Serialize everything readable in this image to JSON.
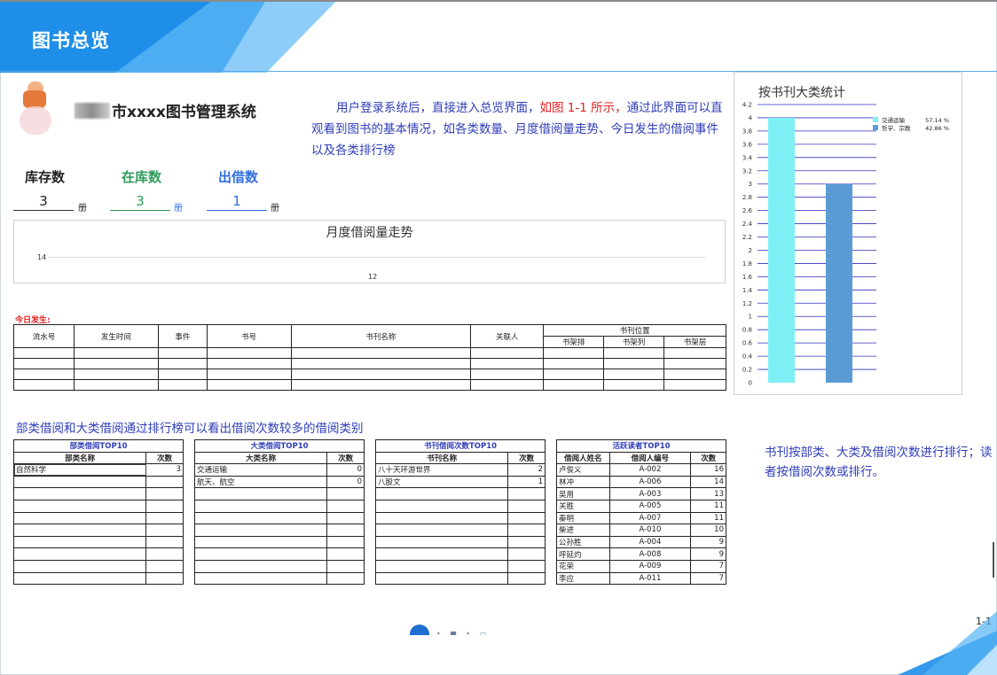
{
  "banner": {
    "title": "图书总览"
  },
  "app": {
    "title": "市xxxx图书管理系统"
  },
  "description": {
    "part1": "用户登录系统后，直接进入总览界面，",
    "highlight": "如图 1-1 所示，",
    "part2": "通过此界面可以直观看到图书的基本情况，如各类数量、月度借阅量走势、今日发生的借阅事件以及各类排行榜"
  },
  "stats": [
    {
      "label": "库存数",
      "value": "3",
      "unit": "册",
      "color": "#111111"
    },
    {
      "label": "在库数",
      "value": "3",
      "unit": "册",
      "color": "#2e9a5a"
    },
    {
      "label": "出借数",
      "value": "1",
      "unit": "册",
      "color": "#2f6fe0"
    }
  ],
  "trend": {
    "title": "月度借阅量走势",
    "ytick": "14",
    "xtick": "12"
  },
  "today": {
    "label": "今日发生:",
    "columns": [
      "流水号",
      "发生时间",
      "事件",
      "书号",
      "书刊名称",
      "关联人"
    ],
    "location_header": "书刊位置",
    "location_columns": [
      "书架排",
      "书架列",
      "书架层"
    ]
  },
  "ranking": {
    "heading": "部类借阅和大类借阅通过排行榜可以看出借阅次数较多的借阅类别",
    "note": "书刊按部类、大类及借阅次数进行排行；读者按借阅次数或排行。",
    "dept": {
      "caption": "部类借阅TOP10",
      "columns": [
        "部类名称",
        "次数"
      ],
      "rows": [
        [
          "自然科学",
          "3"
        ]
      ]
    },
    "category": {
      "caption": "大类借阅TOP10",
      "columns": [
        "大类名称",
        "次数"
      ],
      "rows": [
        [
          "交通运输",
          "0"
        ],
        [
          "航天、航空",
          "0"
        ]
      ]
    },
    "books": {
      "caption": "书刊借阅次数TOP10",
      "columns": [
        "书刊名称",
        "次数"
      ],
      "rows": [
        [
          "八十天环游世界",
          "2"
        ],
        [
          "八股文",
          "1"
        ]
      ]
    },
    "readers": {
      "caption": "活跃读者TOP10",
      "columns": [
        "借阅人姓名",
        "借阅人编号",
        "次数"
      ],
      "rows": [
        [
          "卢俊义",
          "A-002",
          "16"
        ],
        [
          "林冲",
          "A-006",
          "14"
        ],
        [
          "吴用",
          "A-003",
          "13"
        ],
        [
          "关胜",
          "A-005",
          "11"
        ],
        [
          "秦明",
          "A-007",
          "11"
        ],
        [
          "柴进",
          "A-010",
          "10"
        ],
        [
          "公孙胜",
          "A-004",
          "9"
        ],
        [
          "呼延灼",
          "A-008",
          "9"
        ],
        [
          "花荣",
          "A-009",
          "7"
        ],
        [
          "李应",
          "A-011",
          "7"
        ]
      ]
    }
  },
  "chart_data": {
    "type": "bar",
    "title": "按书刊大类统计",
    "categories": [
      "交通运输",
      "哲学、宗教"
    ],
    "values": [
      4,
      3
    ],
    "ylim": [
      0,
      4.2
    ],
    "yticks": [
      "0",
      "0.2",
      "0.4",
      "0.6",
      "0.8",
      "1",
      "1.2",
      "1.4",
      "1.6",
      "1.8",
      "2",
      "2.2",
      "2.4",
      "2.6",
      "2.8",
      "3",
      "3.2",
      "3.4",
      "3.6",
      "3.8",
      "4",
      "4.2"
    ],
    "colors": [
      "#7ef0f5",
      "#5b9bd5"
    ],
    "gridline_color": "#3030c0",
    "legend": [
      {
        "name": "交通运输",
        "percent": "57.14 %"
      },
      {
        "name": "哲学、宗教",
        "percent": "42.86 %"
      }
    ],
    "legend_position": "right"
  },
  "footer": {
    "page": "1-1"
  },
  "colors": {
    "accent": "#2f3db8",
    "highlight": "#e02020",
    "banner": "#1e8ee8"
  }
}
